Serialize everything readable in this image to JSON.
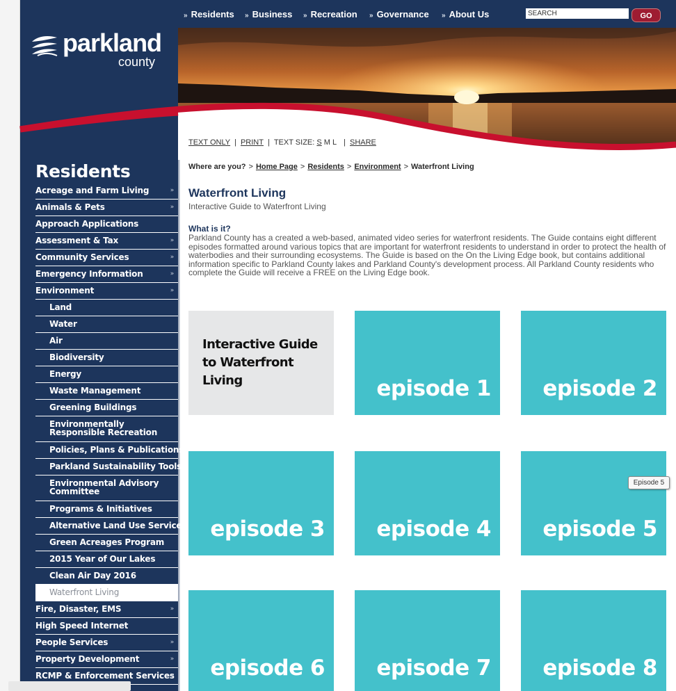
{
  "topnav": {
    "items": [
      "Residents",
      "Business",
      "Recreation",
      "Governance",
      "About Us"
    ],
    "search_placeholder": "SEARCH",
    "go_label": "GO"
  },
  "logo": {
    "main": "parkland",
    "sub": "county"
  },
  "utility": {
    "text_only": "TEXT ONLY",
    "print": "PRINT",
    "text_size_label": "TEXT SIZE:",
    "size_s": "S",
    "size_m": "M",
    "size_l": "L",
    "share": "SHARE",
    "separator": "|"
  },
  "breadcrumb": {
    "prefix": "Where are you?",
    "links": [
      "Home Page",
      "Residents",
      "Environment"
    ],
    "current": "Waterfront Living",
    "separator": ">"
  },
  "content": {
    "title": "Waterfront Living",
    "subtitle": "Interactive Guide to Waterfront Living",
    "what_heading": "What is it?",
    "what_body": "Parkland County has a created a web-based, animated video series for waterfront residents. The Guide contains eight different episodes formatted around various topics that are important for waterfront residents to understand in order to protect the health of waterbodies and their surrounding ecosystems. The Guide is based on the On the Living Edge book, but contains additional information specific to Parkland County lakes and Parkland County's development process. All Parkland County residents who complete the Guide will receive a FREE on the Living Edge book."
  },
  "tiles": {
    "intro": "Interactive Guide to Waterfront Living",
    "episodes": [
      "episode 1",
      "episode 2",
      "episode 3",
      "episode 4",
      "episode 5",
      "episode 6",
      "episode 7",
      "episode 8"
    ],
    "tile_color": "#44c1cb",
    "intro_color": "#e6e7e8"
  },
  "tooltip": "Episode 5",
  "sidebar": {
    "section_title": "Residents",
    "bullet": "»",
    "items": [
      {
        "label": "Acreage and Farm Living"
      },
      {
        "label": "Animals & Pets"
      },
      {
        "label": "Approach Applications"
      },
      {
        "label": "Assessment & Tax"
      },
      {
        "label": "Community Services"
      },
      {
        "label": "Emergency Information"
      },
      {
        "label": "Environment"
      },
      {
        "label": "Land"
      },
      {
        "label": "Water"
      },
      {
        "label": "Air"
      },
      {
        "label": "Biodiversity"
      },
      {
        "label": "Energy"
      },
      {
        "label": "Waste Management"
      },
      {
        "label": "Greening Buildings"
      },
      {
        "label": "Environmentally Responsible Recreation"
      },
      {
        "label": "Policies, Plans & Publications"
      },
      {
        "label": "Parkland Sustainability Tools"
      },
      {
        "label": "Environmental Advisory Committee"
      },
      {
        "label": "Programs & Initiatives"
      },
      {
        "label": "Alternative Land Use Services"
      },
      {
        "label": "Green Acreages Program"
      },
      {
        "label": "2015 Year of Our Lakes"
      },
      {
        "label": "Clean Air Day 2016"
      },
      {
        "label": "Waterfront Living"
      },
      {
        "label": "Fire, Disaster, EMS"
      },
      {
        "label": "High Speed Internet"
      },
      {
        "label": "People Services"
      },
      {
        "label": "Property Development"
      },
      {
        "label": "RCMP & Enforcement Services"
      }
    ]
  },
  "colors": {
    "navy": "#1d355c",
    "accent_red": "#c8102e",
    "go_button": "#9e1c32",
    "episode_teal": "#44c1cb"
  }
}
